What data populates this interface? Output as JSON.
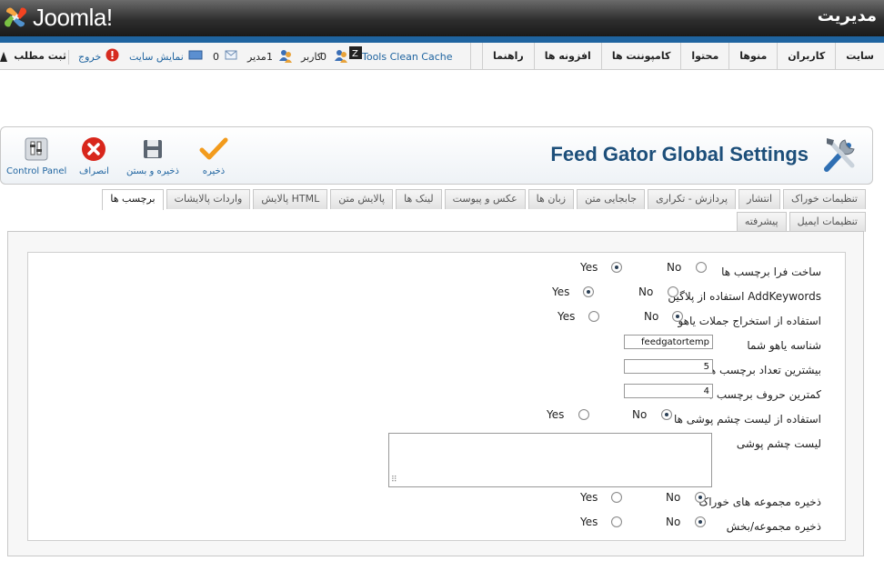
{
  "header": {
    "logo_text": "Joomla!",
    "title": "مدیریت"
  },
  "menu": [
    "سایت",
    "کاربران",
    "منوها",
    "محتوا",
    "کامپوننت ها",
    "افزونه ها",
    "راهنما"
  ],
  "status": {
    "tools_clean_cache": "Tools Clean Cache",
    "users_count": "0",
    "users_label": "کاربر",
    "admins_count": "1",
    "admins_label": "مدیر",
    "messages_count": "0",
    "view_site": "نمایش سایت",
    "logout": "خروج",
    "register": "ثبت مطلب"
  },
  "page": {
    "title": "Feed Gator Global Settings"
  },
  "toolbar": {
    "save": "ذخیره",
    "save_close": "ذخیره و بستن",
    "cancel": "انصراف",
    "control_panel": "Control Panel"
  },
  "tabs_row1": [
    "تنظیمات خوراک",
    "انتشار",
    "پردازش - تکراری",
    "جابجایی متن",
    "زبان ها",
    "عکس و پیوست",
    "لینک ها",
    "پالایش متن",
    "پالایش HTML",
    "واردات پالایشات",
    "برچسب ها"
  ],
  "tabs_row2": [
    "تنظیمات ایمیل",
    "پیشرفته"
  ],
  "active_tab": "برچسب ها",
  "form": {
    "no": "No",
    "yes": "Yes",
    "make_meta_tags": {
      "label": "ساخت فرا برچسب ها",
      "value": "Yes"
    },
    "use_addkeywords": {
      "label": "استفاده از پلاگین AddKeywords",
      "value": "Yes"
    },
    "use_yahoo_extract": {
      "label": "استفاده از استخراج جملات یاهو",
      "value": "No"
    },
    "yahoo_id": {
      "label": "شناسه یاهو شما",
      "value": "feedgatortemp"
    },
    "max_tags": {
      "label": "بیشترین تعداد برچسب ها",
      "value": "5"
    },
    "min_tag_chars": {
      "label": "کمترین حروف برچسب ها",
      "value": "4"
    },
    "use_ignore_list": {
      "label": "استفاده از لیست چشم پوشی ها",
      "value": "No"
    },
    "ignore_list": {
      "label": "لیست چشم پوشی",
      "value": ""
    },
    "save_feed_sets": {
      "label": "ذخیره مجموعه های خوراک",
      "value": "No"
    },
    "save_section_category": {
      "label": "ذخیره مجموعه/بخش",
      "value": "No"
    }
  },
  "colors": {
    "blue_bar": "#1f64a0",
    "title": "#1d4f7a"
  }
}
